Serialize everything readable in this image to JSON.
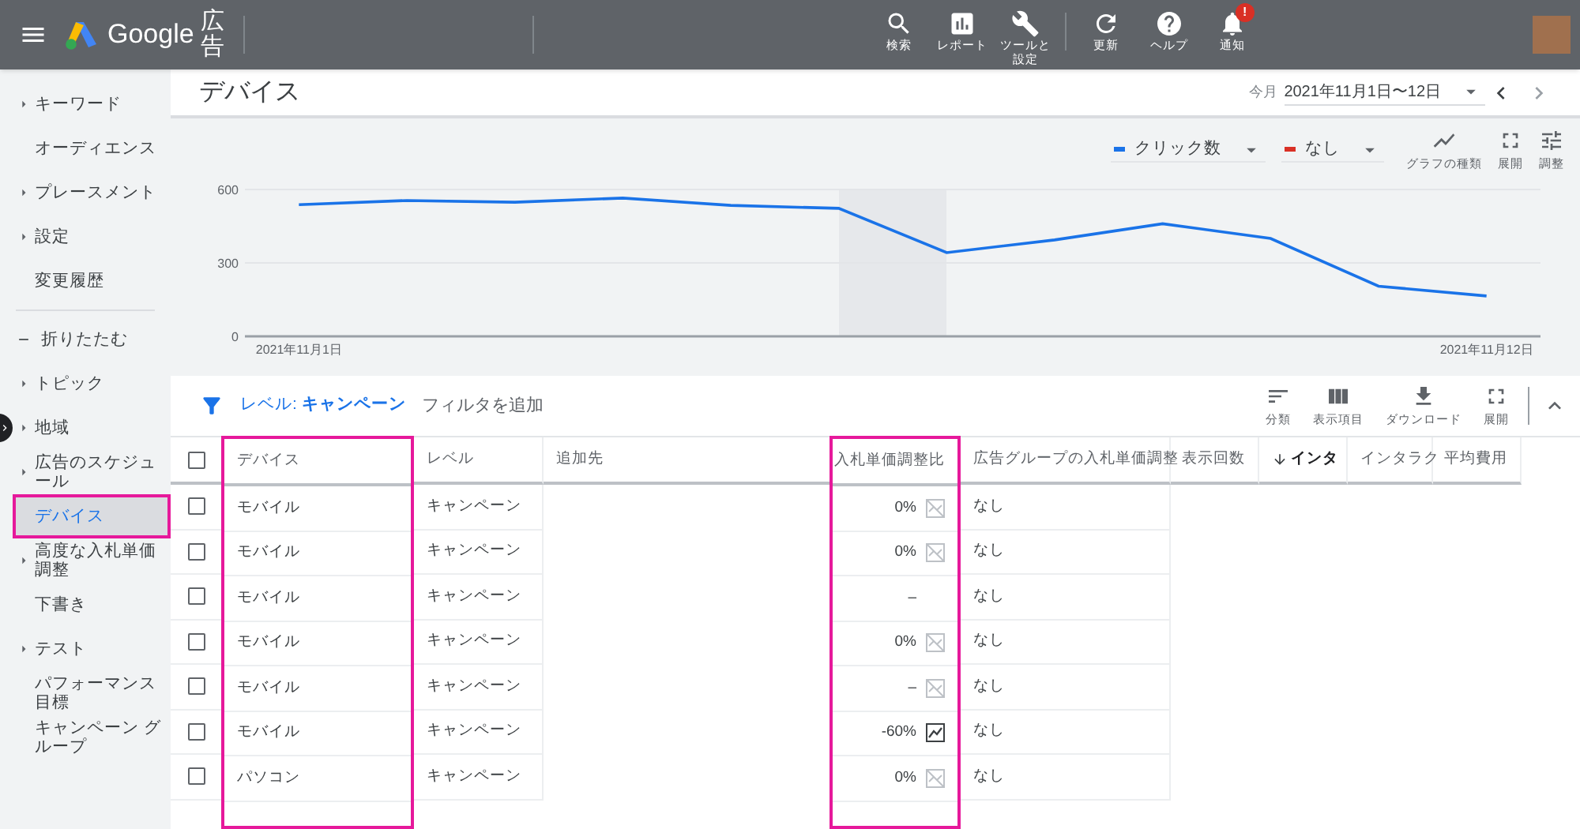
{
  "header": {
    "logo_text": "Google",
    "product": "広告",
    "badge": "!",
    "actions": [
      {
        "kind": "search",
        "label": "検索"
      },
      {
        "kind": "report",
        "label": "レポート"
      },
      {
        "kind": "tools",
        "label": "ツールと設定"
      },
      {
        "kind": "refresh",
        "label": "更新"
      },
      {
        "kind": "help",
        "label": "ヘルプ"
      },
      {
        "kind": "notifications",
        "label": "通知"
      }
    ]
  },
  "sidebar": {
    "items": [
      {
        "label": "キーワード",
        "kind": "group",
        "selected": false
      },
      {
        "label": "オーディエンス",
        "kind": "link",
        "selected": false
      },
      {
        "label": "プレースメント",
        "kind": "group",
        "selected": false
      },
      {
        "label": "設定",
        "kind": "group",
        "selected": false
      },
      {
        "label": "変更履歴",
        "kind": "link",
        "selected": false
      },
      {
        "label": "折りたたむ",
        "kind": "collapse",
        "selected": false
      },
      {
        "label": "トピック",
        "kind": "group",
        "selected": false
      },
      {
        "label": "地域",
        "kind": "group",
        "selected": false
      },
      {
        "label": "広告のスケジュール",
        "kind": "group",
        "selected": false
      },
      {
        "label": "デバイス",
        "kind": "link",
        "selected": true,
        "highlighted": true
      },
      {
        "label": "高度な入札単価調整",
        "kind": "group",
        "selected": false
      },
      {
        "label": "下書き",
        "kind": "link",
        "selected": false
      },
      {
        "label": "テスト",
        "kind": "group",
        "selected": false
      },
      {
        "label": "パフォーマンス目標",
        "kind": "link",
        "selected": false
      },
      {
        "label": "キャンペーン グループ",
        "kind": "link",
        "selected": false
      }
    ]
  },
  "page": {
    "title": "デバイス",
    "range_label": "今月",
    "date_range": "2021年11月1日〜12日"
  },
  "chart_toolbar": {
    "metrics": [
      {
        "label": "なし",
        "color": "#d93025"
      }
    ],
    "tools": [
      {
        "kind": "chart-type",
        "label": "グラフの種類"
      },
      {
        "kind": "expand",
        "label": "展開"
      },
      {
        "kind": "adjust",
        "label": "調整"
      }
    ]
  },
  "chart_data": {
    "type": "line",
    "categories": [
      "2021年11月1日",
      null,
      null,
      null,
      null,
      null,
      null,
      null,
      null,
      null,
      null,
      "2021年11月12日"
    ],
    "yticks": [
      0,
      300,
      600
    ],
    "ylim": [
      0,
      600
    ],
    "series": [
      {
        "name": "クリック数",
        "color": "#1a73e8",
        "values": [
          538,
          555,
          548,
          565,
          535,
          523,
          342,
          394,
          460,
          400,
          205,
          165
        ]
      }
    ]
  },
  "filter_bar": {
    "level": "レベル: **キャンペーン**",
    "add_filter": "フィルタを追加",
    "tools": [
      {
        "kind": "segment",
        "label": "分類"
      },
      {
        "kind": "columns",
        "label": "表示項目"
      },
      {
        "kind": "download",
        "label": "ダウンロード"
      },
      {
        "kind": "expand",
        "label": "展開"
      }
    ]
  },
  "table": {
    "header_checkbox": {
      "checked": false
    },
    "columns": [
      {
        "label": "デバイス",
        "highlighted": true,
        "sorted": false
      },
      {
        "label": "レベル",
        "highlighted": false,
        "sorted": false
      },
      {
        "label": "追加先",
        "highlighted": false,
        "sorted": false
      },
      {
        "label": "入札単価調整比",
        "highlighted": true,
        "sorted": false
      },
      {
        "label": "広告グループの入札単価調整",
        "highlighted": false,
        "sorted": false
      },
      {
        "label": "表示回数",
        "highlighted": false,
        "sorted": false
      },
      {
        "label": "インタ",
        "highlighted": false,
        "sorted": true
      },
      {
        "label": "インタラク",
        "highlighted": false,
        "sorted": false
      },
      {
        "label": "平均費用",
        "highlighted": false,
        "sorted": false
      }
    ],
    "rows": [
      {
        "checked": false,
        "device": "モバイル",
        "level": "キャンペーン",
        "bid": {
          "value": "0%",
          "kind": "chart-off"
        },
        "ad_group": "なし"
      },
      {
        "checked": false,
        "device": "モバイル",
        "level": "キャンペーン",
        "bid": {
          "value": "0%",
          "kind": "chart-off"
        },
        "ad_group": "なし"
      },
      {
        "checked": false,
        "device": "モバイル",
        "level": "キャンペーン",
        "bid": {
          "value": "–",
          "kind": "plain"
        },
        "ad_group": "なし"
      },
      {
        "checked": false,
        "device": "モバイル",
        "level": "キャンペーン",
        "bid": {
          "value": "0%",
          "kind": "chart-off"
        },
        "ad_group": "なし"
      },
      {
        "checked": false,
        "device": "モバイル",
        "level": "キャンペーン",
        "bid": {
          "value": "–",
          "kind": "chart-off"
        },
        "ad_group": "なし"
      },
      {
        "checked": false,
        "device": "モバイル",
        "level": "キャンペーン",
        "bid": {
          "value": "-60%",
          "kind": "chart-on"
        },
        "ad_group": "なし"
      },
      {
        "checked": false,
        "device": "パソコン",
        "level": "キャンペーン",
        "bid": {
          "value": "0%",
          "kind": "chart-off"
        },
        "ad_group": "なし"
      }
    ]
  }
}
